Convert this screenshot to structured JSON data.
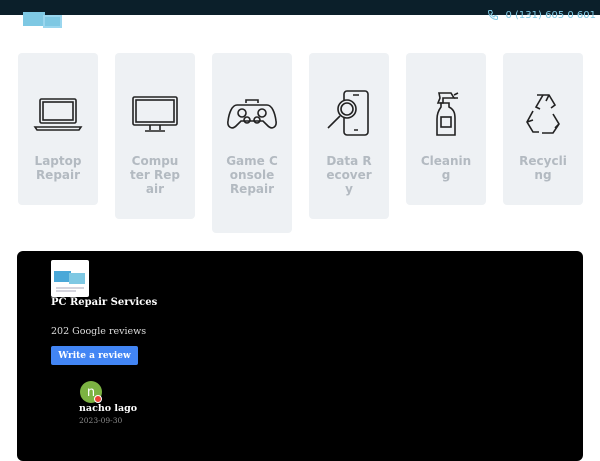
{
  "header": {
    "phone": "0 (131) 605 0 601",
    "logo_icon": "monitors-logo-icon",
    "phone_icon": "phone-icon",
    "accent_color": "#7ec8e3",
    "bar_color": "#0b1f2a"
  },
  "services": [
    {
      "label": "Laptop Repair",
      "icon": "laptop-icon"
    },
    {
      "label": "Computer Repair",
      "icon": "monitor-icon"
    },
    {
      "label": "Game Console Repair",
      "icon": "gamepad-icon"
    },
    {
      "label": "Data Recovery",
      "icon": "phone-search-icon"
    },
    {
      "label": "Cleaning",
      "icon": "spray-bottle-icon"
    },
    {
      "label": "Recycling",
      "icon": "recycle-icon"
    }
  ],
  "reviews_widget": {
    "business_name": "PC Repair Services",
    "review_count": "202 Google reviews",
    "write_review_label": "Write a review",
    "button_color": "#4285f4",
    "review": {
      "avatar_initial": "n",
      "avatar_color": "#7cb342",
      "reviewer_name": "nacho lago",
      "date": "2023-09-30"
    }
  }
}
